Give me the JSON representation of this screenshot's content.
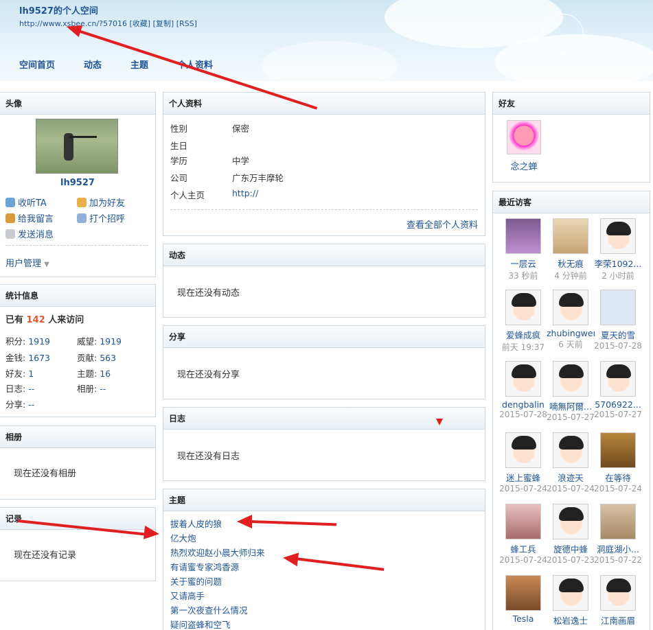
{
  "header": {
    "title": "lh9527的个人空间",
    "url": "http://www.xsbee.cn/?57016",
    "links": [
      "[收藏]",
      "[复制]",
      "[RSS]"
    ]
  },
  "nav": [
    "空间首页",
    "动态",
    "主题",
    "个人资料"
  ],
  "avatar": {
    "heading": "头像",
    "username": "lh9527",
    "actions": [
      "收听TA",
      "加为好友",
      "给我留言",
      "打个招呼",
      "发送消息"
    ],
    "user_manage": "用户管理"
  },
  "stats": {
    "heading": "统计信息",
    "visit_prefix": "已有",
    "visit_count": "142",
    "visit_suffix": "人来访问",
    "items": [
      [
        "积分:",
        "1919"
      ],
      [
        "威望:",
        "1919"
      ],
      [
        "金钱:",
        "1673"
      ],
      [
        "贡献:",
        "563"
      ],
      [
        "好友:",
        "1"
      ],
      [
        "主题:",
        "16"
      ],
      [
        "日志:",
        "--"
      ],
      [
        "相册:",
        "--"
      ],
      [
        "分享:",
        "--"
      ]
    ]
  },
  "album": {
    "heading": "相册",
    "empty": "现在还没有相册"
  },
  "records": {
    "heading": "记录",
    "empty": "现在还没有记录"
  },
  "profile": {
    "heading": "个人资料",
    "rows": [
      [
        "性别",
        "保密"
      ],
      [
        "生日",
        ""
      ],
      [
        "学历",
        "中学"
      ],
      [
        "公司",
        "广东万丰摩轮"
      ],
      [
        "个人主页",
        "http://"
      ]
    ],
    "view_all": "查看全部个人资料"
  },
  "feed": {
    "heading": "动态",
    "empty": "现在还没有动态"
  },
  "share": {
    "heading": "分享",
    "empty": "现在还没有分享"
  },
  "blog": {
    "heading": "日志",
    "empty": "现在还没有日志"
  },
  "topics": {
    "heading": "主题",
    "items": [
      "拔着人皮的狼",
      "亿大炮",
      "热烈欢迎赵小晨大师归来",
      "有请蜜专家鸿香源",
      "关于蜜的问题",
      "又请高手",
      "第一次夜查什么情况",
      "疑问盗蜂和空飞"
    ]
  },
  "friends": {
    "heading": "好友",
    "items": [
      "念之蝉"
    ]
  },
  "visitors": {
    "heading": "最近访客",
    "items": [
      [
        "一层云",
        "33 秒前"
      ],
      [
        "秋无痕",
        "4 分钟前"
      ],
      [
        "李荣1092...",
        "2 小时前"
      ],
      [
        "爱蜂成疯",
        "前天 19:37"
      ],
      [
        "zhubingwen",
        "6 天前"
      ],
      [
        "夏天的雪",
        "2015-07-28"
      ],
      [
        "dengbalin",
        "2015-07-28"
      ],
      [
        "喃無阿爾...",
        "2015-07-27"
      ],
      [
        "5706922...",
        "2015-07-27"
      ],
      [
        "迷上蜜蜂",
        "2015-07-24"
      ],
      [
        "浪迹天",
        "2015-07-24"
      ],
      [
        "在等待",
        "2015-07-24"
      ],
      [
        "蜂工兵",
        "2015-07-24"
      ],
      [
        "旋德中蜂",
        "2015-07-23"
      ],
      [
        "洞庭湖小...",
        "2015-07-22"
      ],
      [
        "Tesla",
        ""
      ],
      [
        "松岩逸士",
        ""
      ],
      [
        "江南画眉",
        ""
      ]
    ]
  }
}
